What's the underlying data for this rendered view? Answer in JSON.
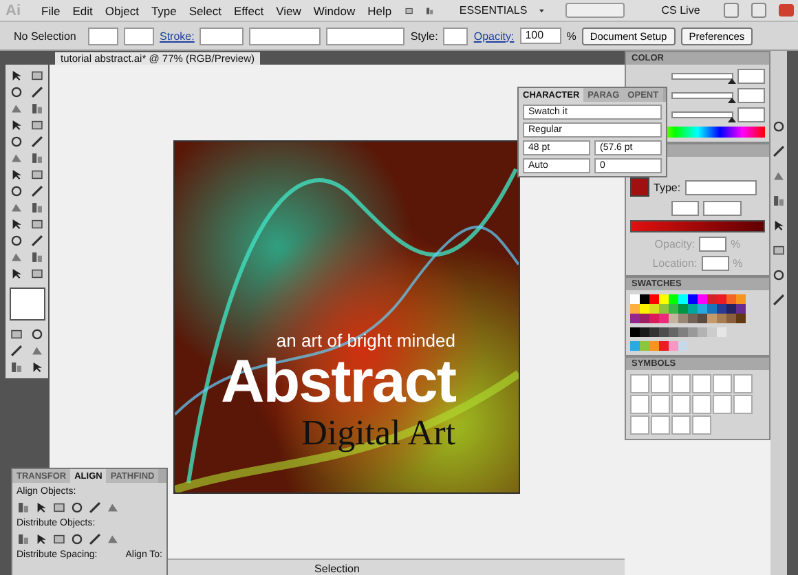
{
  "menu_bar": {
    "app_logo": "Ai",
    "items": [
      "File",
      "Edit",
      "Object",
      "Type",
      "Select",
      "Effect",
      "View",
      "Window",
      "Help"
    ],
    "workspace": "ESSENTIALS",
    "cs_live": "CS Live"
  },
  "control_bar": {
    "selection": "No Selection",
    "stroke_label": "Stroke:",
    "style_label": "Style:",
    "opacity_label": "Opacity:",
    "opacity_value": "100",
    "opacity_unit": "%",
    "buttons": [
      "Document Setup",
      "Preferences"
    ]
  },
  "document": {
    "tab": "tutorial abstract.ai* @ 77% (RGB/Preview)",
    "art_texts": [
      {
        "kind": "tagline",
        "text": "an art of bright minded"
      },
      {
        "kind": "headline",
        "text": "Abstract"
      },
      {
        "kind": "subtitle",
        "text": "Digital Art"
      }
    ],
    "status": "Selection"
  },
  "character_panel": {
    "tabs": [
      {
        "label": "CHARACTER",
        "selected": true
      },
      {
        "label": "PARAG",
        "selected": false
      },
      {
        "label": "OPENT",
        "selected": false
      }
    ],
    "font": "Swatch it",
    "style": "Regular",
    "size": "48 pt",
    "leading": "(57.6 pt",
    "kerning": "Auto",
    "tracking": "0"
  },
  "color_panel": {
    "title": "COLOR",
    "channels": [
      {
        "level": 1
      },
      {
        "level": 1
      },
      {
        "level": 1
      }
    ]
  },
  "gradient_panel": {
    "type_label": "Type:",
    "opacity_label": "Opacity:",
    "location_label": "Location:",
    "percent_signs": [
      "%",
      "%"
    ]
  },
  "swatches_panel": {
    "title": "SWATCHES",
    "swatches": [
      {
        "color": "#ffffff"
      },
      {
        "color": "#000000"
      },
      {
        "color": "#ff0000"
      },
      {
        "color": "#ffff00"
      },
      {
        "color": "#00ff00"
      },
      {
        "color": "#00ffff"
      },
      {
        "color": "#0000ff"
      },
      {
        "color": "#ff00ff"
      },
      {
        "color": "#d2232a"
      },
      {
        "color": "#ed1c24"
      },
      {
        "color": "#f26522"
      },
      {
        "color": "#f7941d"
      },
      {
        "color": "#fbb040"
      },
      {
        "color": "#fff200"
      },
      {
        "color": "#d7df23"
      },
      {
        "color": "#8dc63f"
      },
      {
        "color": "#39b54a"
      },
      {
        "color": "#009444"
      },
      {
        "color": "#00a79d"
      },
      {
        "color": "#27aae1"
      },
      {
        "color": "#1c75bc"
      },
      {
        "color": "#2b3990"
      },
      {
        "color": "#262262"
      },
      {
        "color": "#662d91"
      },
      {
        "color": "#92278f"
      },
      {
        "color": "#9e1f63"
      },
      {
        "color": "#da1c5c"
      },
      {
        "color": "#ee2a7b"
      },
      {
        "color": "#c2b59b"
      },
      {
        "color": "#998675"
      },
      {
        "color": "#736357"
      },
      {
        "color": "#594a42"
      },
      {
        "color": "#c49a6c"
      },
      {
        "color": "#a97c50"
      },
      {
        "color": "#8b5e3c"
      },
      {
        "color": "#603913"
      }
    ],
    "grays": [
      {
        "color": "#000000"
      },
      {
        "color": "#1a1a1a"
      },
      {
        "color": "#333333"
      },
      {
        "color": "#4d4d4d"
      },
      {
        "color": "#666666"
      },
      {
        "color": "#808080"
      },
      {
        "color": "#999999"
      },
      {
        "color": "#b3b3b3"
      },
      {
        "color": "#cccccc"
      },
      {
        "color": "#e6e6e6"
      }
    ],
    "extra": [
      {
        "color": "#29abe2"
      },
      {
        "color": "#8cc63f"
      },
      {
        "color": "#f7931e"
      },
      {
        "color": "#ed1c24"
      },
      {
        "color": "#f49ac1"
      },
      {
        "color": "#c7d8e8"
      }
    ]
  },
  "symbols_panel": {
    "title": "SYMBOLS"
  },
  "align_panel": {
    "tabs": [
      {
        "label": "TRANSFOR",
        "selected": false
      },
      {
        "label": "ALIGN",
        "selected": true
      },
      {
        "label": "PATHFIND",
        "selected": false
      }
    ],
    "align_objects": "Align Objects:",
    "distribute_objects": "Distribute Objects:",
    "distribute_spacing": "Distribute Spacing:",
    "align_to": "Align To:"
  }
}
